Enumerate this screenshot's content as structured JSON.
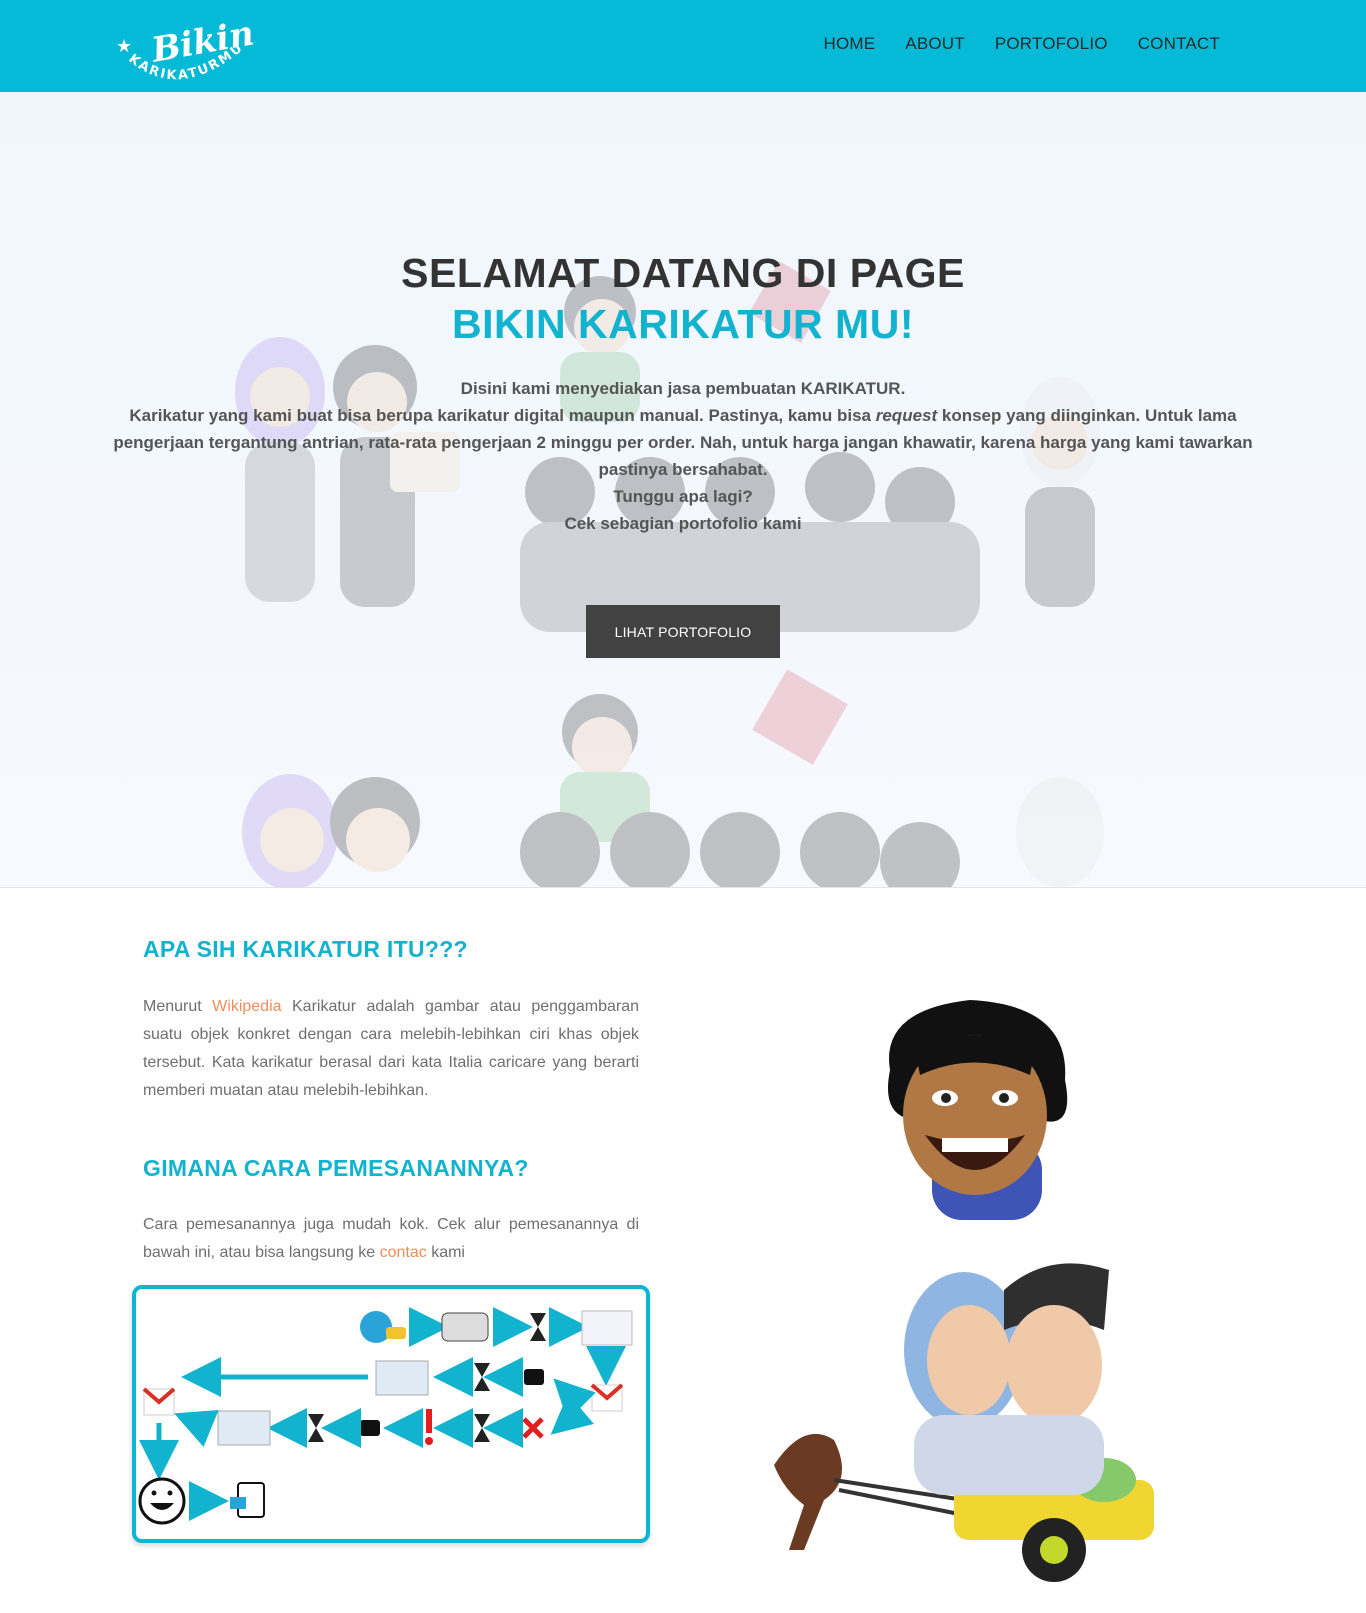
{
  "navbar": {
    "logo_main": "Bikin",
    "logo_sub": "KARIKATURMU",
    "links": [
      {
        "label": "HOME"
      },
      {
        "label": "ABOUT"
      },
      {
        "label": "PORTOFOLIO"
      },
      {
        "label": "CONTACT"
      }
    ]
  },
  "hero": {
    "title_line1": "SELAMAT DATANG DI PAGE",
    "title_line2": "BIKIN KARIKATUR MU!",
    "para1": "Disini kami menyediakan jasa pembuatan KARIKATUR.",
    "para2_before": "Karikatur yang kami buat bisa berupa karikatur digital maupun manual. Pastinya, kamu bisa ",
    "para2_em": "request",
    "para2_after": " konsep yang diinginkan. Untuk lama pengerjaan tergantung antrian, rata-rata pengerjaan 2 minggu per order. Nah, untuk harga jangan khawatir, karena harga yang kami tawarkan pastinya bersahabat.",
    "para3": "Tunggu apa lagi?",
    "para4": "Cek sebagian portofolio kami",
    "button_label": "LIHAT PORTOFOLIO"
  },
  "about": {
    "heading": "APA SIH KARIKATUR ITU???",
    "text_before": "Menurut ",
    "link_label": "Wikipedia",
    "text_after": " Karikatur adalah gambar atau penggambaran suatu objek konkret dengan cara melebih-lebihkan ciri khas objek tersebut. Kata karikatur berasal dari kata Italia caricare yang berarti memberi muatan atau melebih-lebihkan."
  },
  "order": {
    "heading": "GIMANA CARA PEMESANANNYA?",
    "text_before": "Cara pemesanannya juga mudah kok. Cek alur pemesanannya di bawah ini, atau bisa langsung ke ",
    "link_label": "contac",
    "text_after": " kami"
  },
  "colors": {
    "accent": "#04bad6",
    "heading": "#12b3cf",
    "link": "#ed8e5c",
    "button": "#424242"
  }
}
